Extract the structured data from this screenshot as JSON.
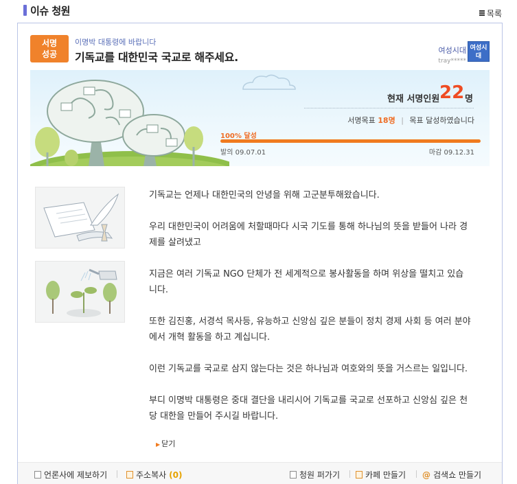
{
  "header": {
    "section_title": "이슈 청원",
    "list_label": "목록"
  },
  "petition": {
    "badge_line1": "서명",
    "badge_line2": "성공",
    "addressee": "이명박 대통령에 바랍니다",
    "title": "기독교를 대한민국 국교로 해주세요.",
    "author_name": "여성시대",
    "author_id": "tray*****",
    "author_avatar_text": "여성시대"
  },
  "stats": {
    "count_label": "현재 서명인원",
    "count_value": "22",
    "count_unit": "명",
    "goal_label": "서명목표",
    "goal_value": "18명",
    "goal_status": "목표 달성하였습니다",
    "percent_label": "100% 달성",
    "progress_percent": 100,
    "start_label": "발의",
    "start_date": "09.07.01",
    "end_label": "마감",
    "end_date": "09.12.31"
  },
  "content": {
    "paragraphs": [
      "기독교는 언제나 대한민국의 안녕을 위해 고군분투해왔습니다.",
      "우리 대한민국이 어려움에 처할때마다 시국 기도를 통해 하나님의 뜻을 받들어 나라 경제를 살려냈고",
      "지금은 여러 기독교 NGO 단체가 전 세계적으로 봉사활동을 하며 위상을 떨치고 있습니다.",
      "또한 김진홍, 서경석 목사등, 유능하고 신앙심 깊은 분들이 정치 경제 사회 등 여러 분야에서 개혁 활동을 하고 계십니다.",
      "이런 기독교를 국교로 삼지 않는다는 것은 하나님과 여호와의 뜻을 거스르는 일입니다.",
      "부디 이명박 대통령은 중대 결단을 내리시어 기독교를 국교로 선포하고 신앙심 깊은 천당 대한을 만들어 주시길 바랍니다."
    ],
    "close_label": "닫기"
  },
  "footer": {
    "report_label": "언론사에 제보하기",
    "copy_label": "주소복사",
    "copy_count": "(0)",
    "share_label": "청원 퍼가기",
    "cafe_label": "카페 만들기",
    "search_label": "검색쇼 만들기"
  },
  "colors": {
    "accent": "#f0822b",
    "title_marker": "#6b6fd8",
    "count": "#ef4c23",
    "frame_border": "#b9c4e6"
  }
}
